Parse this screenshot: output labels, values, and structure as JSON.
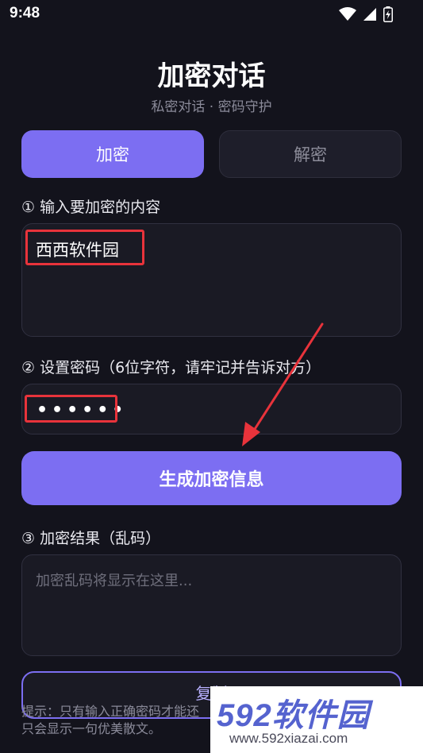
{
  "status_bar": {
    "time": "9:48",
    "icons": [
      "wifi-icon",
      "signal-icon",
      "battery-charging-icon"
    ]
  },
  "header": {
    "title": "加密对话",
    "subtitle": "私密对话 · 密码守护"
  },
  "tabs": [
    {
      "label": "加密",
      "active": true
    },
    {
      "label": "解密",
      "active": false
    }
  ],
  "content_section": {
    "label": "① 输入要加密的内容",
    "value": "西西软件园"
  },
  "password_section": {
    "label": "② 设置密码（6位字符，请牢记并告诉对方）",
    "masked_value": "••••••"
  },
  "generate_button": {
    "label": "生成加密信息"
  },
  "result_section": {
    "label": "③ 加密结果（乱码）",
    "placeholder": "加密乱码将显示在这里..."
  },
  "copy_button": {
    "label": "复制"
  },
  "hint": {
    "text": "提示：只有输入正确密码才能还\n只会显示一句优美散文。"
  },
  "watermark": {
    "logo": "592软件园",
    "url": "www.592xiazai.com"
  },
  "colors": {
    "background": "#13131c",
    "accent": "#7c6ef2",
    "annotation_red": "#e8333b"
  }
}
